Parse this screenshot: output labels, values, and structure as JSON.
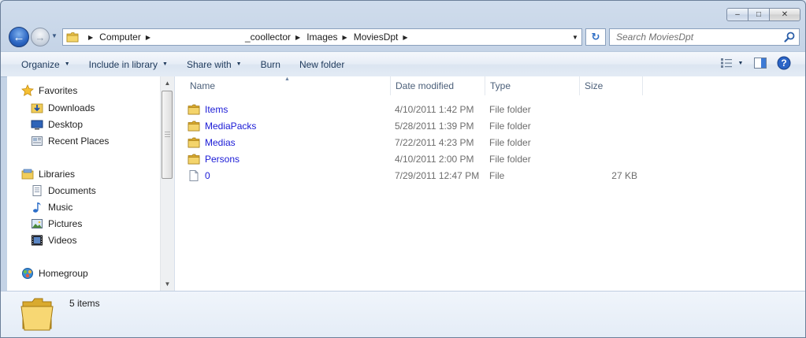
{
  "window": {
    "caption_buttons": {
      "minimize": "–",
      "maximize": "□",
      "close": "✕"
    }
  },
  "navigation": {
    "back_glyph": "←",
    "forward_glyph": "→",
    "recent_glyph": "▼",
    "breadcrumbs": [
      "Computer",
      "_coollector",
      "Images",
      "MoviesDpt"
    ],
    "address_dropdown_glyph": "▼",
    "refresh_glyph": "↻"
  },
  "search": {
    "placeholder": "Search MoviesDpt"
  },
  "commandbar": {
    "organize": "Organize",
    "include_in_library": "Include in library",
    "share_with": "Share with",
    "burn": "Burn",
    "new_folder": "New folder",
    "dropdown_glyph": "▼",
    "help_glyph": "?"
  },
  "navpane": {
    "favorites": "Favorites",
    "downloads": "Downloads",
    "desktop": "Desktop",
    "recent_places": "Recent Places",
    "libraries": "Libraries",
    "documents": "Documents",
    "music": "Music",
    "pictures": "Pictures",
    "videos": "Videos",
    "homegroup": "Homegroup",
    "scroll_up": "▲",
    "scroll_down": "▼"
  },
  "columns": {
    "name": "Name",
    "date_modified": "Date modified",
    "type": "Type",
    "size": "Size",
    "sort_glyph": "▲"
  },
  "files": [
    {
      "name": "Items",
      "date": "4/10/2011 1:42 PM",
      "type": "File folder",
      "size": "",
      "kind": "folder"
    },
    {
      "name": "MediaPacks",
      "date": "5/28/2011 1:39 PM",
      "type": "File folder",
      "size": "",
      "kind": "folder"
    },
    {
      "name": "Medias",
      "date": "7/22/2011 4:23 PM",
      "type": "File folder",
      "size": "",
      "kind": "folder"
    },
    {
      "name": "Persons",
      "date": "4/10/2011 2:00 PM",
      "type": "File folder",
      "size": "",
      "kind": "folder"
    },
    {
      "name": "0",
      "date": "7/29/2011 12:47 PM",
      "type": "File",
      "size": "27 KB",
      "kind": "file"
    }
  ],
  "details": {
    "count_text": "5 items"
  }
}
